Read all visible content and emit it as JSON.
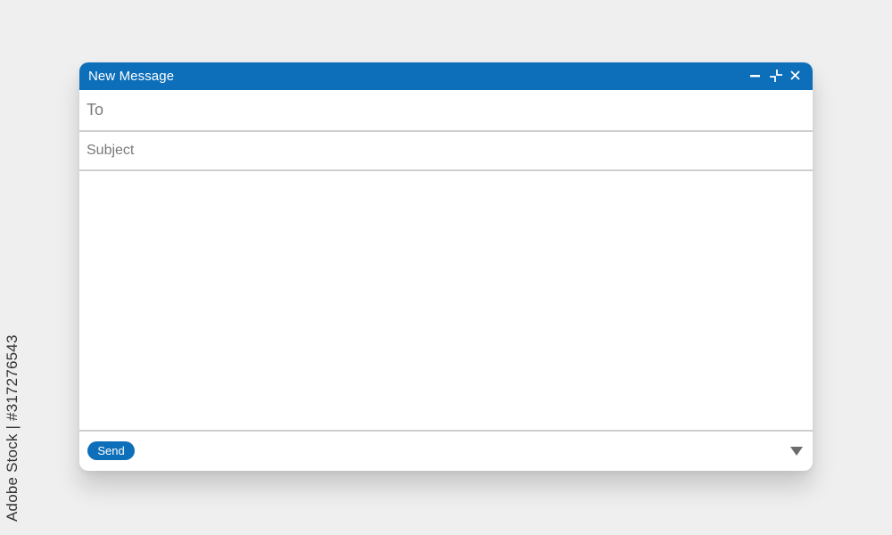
{
  "window": {
    "title": "New Message",
    "controls": [
      "minimize-icon",
      "collapse-icon",
      "close-icon"
    ]
  },
  "fields": {
    "to_placeholder": "To",
    "to_value": "",
    "subject_placeholder": "Subject",
    "subject_value": "",
    "body_value": ""
  },
  "footer": {
    "send_label": "Send",
    "options_icon": "triangle-down-icon"
  },
  "side_label": "Adobe Stock | #317276543",
  "colors": {
    "accent": "#0d6fba",
    "background": "#efefef",
    "window": "#ffffff",
    "divider": "#cfcfcf",
    "placeholder": "#7a7a7a"
  }
}
